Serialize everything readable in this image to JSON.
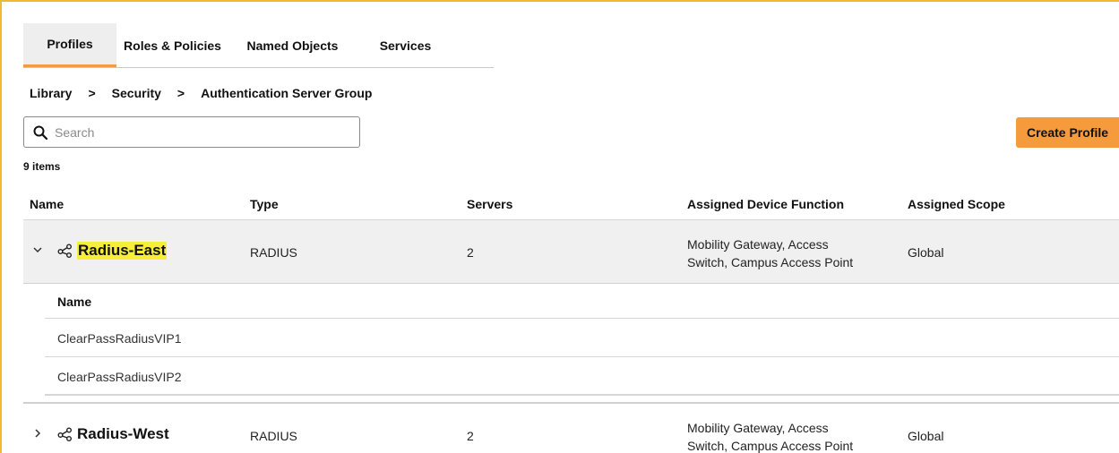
{
  "tabs": [
    {
      "label": "Profiles",
      "active": true
    },
    {
      "label": "Roles & Policies",
      "active": false
    },
    {
      "label": "Named Objects",
      "active": false
    },
    {
      "label": "Services",
      "active": false
    }
  ],
  "breadcrumb": {
    "items": [
      "Library",
      "Security",
      "Authentication Server Group"
    ],
    "separator": ">"
  },
  "search": {
    "placeholder": "Search",
    "value": ""
  },
  "create_button": {
    "label": "Create Profile"
  },
  "items_count": "9 items",
  "table": {
    "headers": [
      "Name",
      "Type",
      "Servers",
      "Assigned Device Function",
      "Assigned Scope"
    ],
    "rows": [
      {
        "name": "Radius-East",
        "type": "RADIUS",
        "servers": "2",
        "function_line1": "Mobility Gateway, Access",
        "function_line2": "Switch, Campus Access Point",
        "scope": "Global",
        "expanded": true,
        "subtable": {
          "header": "Name",
          "items": [
            "ClearPassRadiusVIP1",
            "ClearPassRadiusVIP2"
          ]
        }
      },
      {
        "name": "Radius-West",
        "type": "RADIUS",
        "servers": "2",
        "function_line1": "Mobility Gateway, Access",
        "function_line2": "Switch, Campus Access Point",
        "scope": "Global",
        "expanded": false
      }
    ]
  },
  "colors": {
    "accent": "#f59a3d",
    "frame_border": "#f2b82e",
    "highlight": "#f7ee3a",
    "row_bg": "#f0f0f0"
  },
  "icons": {
    "search": "search-icon",
    "expand_open": "chevron-down-icon",
    "expand_closed": "chevron-right-icon",
    "group": "share-nodes-icon"
  }
}
